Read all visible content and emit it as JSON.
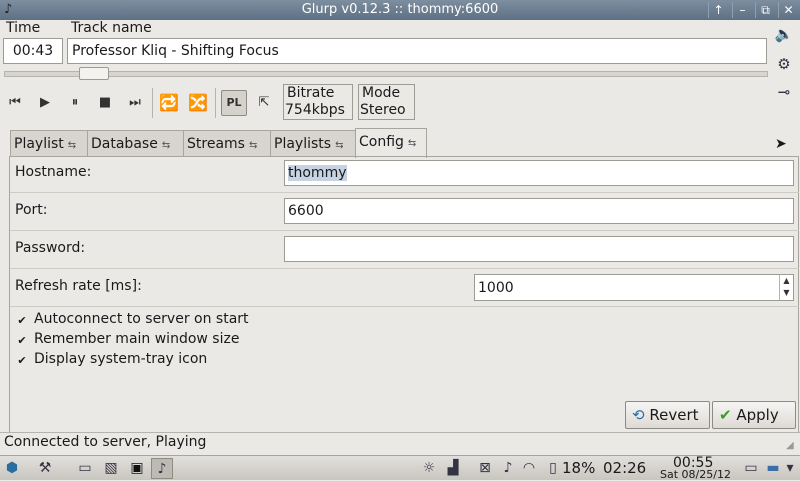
{
  "window": {
    "title": "Glurp v0.12.3 :: thommy:6600",
    "controls": [
      "up-arrow-icon",
      "minimize-icon",
      "restore-icon",
      "close-icon"
    ]
  },
  "player": {
    "time_label": "Time",
    "time_value": "00:43",
    "track_label": "Track name",
    "track_value": "Professor Kliq - Shifting Focus",
    "seek_progress": 0.1,
    "bitrate_label": "Bitrate",
    "bitrate_value": "754kbps",
    "mode_label": "Mode",
    "mode_value": "Stereo",
    "toolbar": [
      "previous-icon",
      "play-icon",
      "pause-icon",
      "stop-icon",
      "next-icon",
      "repeat-icon",
      "random-icon",
      "playlist-toggle-icon",
      "xfade-icon"
    ],
    "side_icons": [
      "volume-icon",
      "outputs-icon",
      "connect-icon"
    ]
  },
  "tabs": [
    {
      "label": "Playlist",
      "selected": false
    },
    {
      "label": "Database",
      "selected": false
    },
    {
      "label": "Streams",
      "selected": false
    },
    {
      "label": "Playlists",
      "selected": false
    },
    {
      "label": "Config",
      "selected": true
    }
  ],
  "config": {
    "hostname_label": "Hostname:",
    "hostname_value": "thommy",
    "port_label": "Port:",
    "port_value": "6600",
    "password_label": "Password:",
    "password_value": "",
    "refresh_label": "Refresh rate [ms]:",
    "refresh_value": "1000",
    "checkboxes": [
      {
        "label": "Autoconnect to server on start",
        "checked": true
      },
      {
        "label": "Remember main window size",
        "checked": true
      },
      {
        "label": "Display system-tray icon",
        "checked": true
      }
    ],
    "revert_label": "Revert",
    "apply_label": "Apply"
  },
  "status": {
    "text": "Connected to server, Playing"
  },
  "taskbar": {
    "battery": "18%",
    "battery_time": "02:26",
    "clock_time": "00:55",
    "clock_date": "Sat 08/25/12"
  }
}
